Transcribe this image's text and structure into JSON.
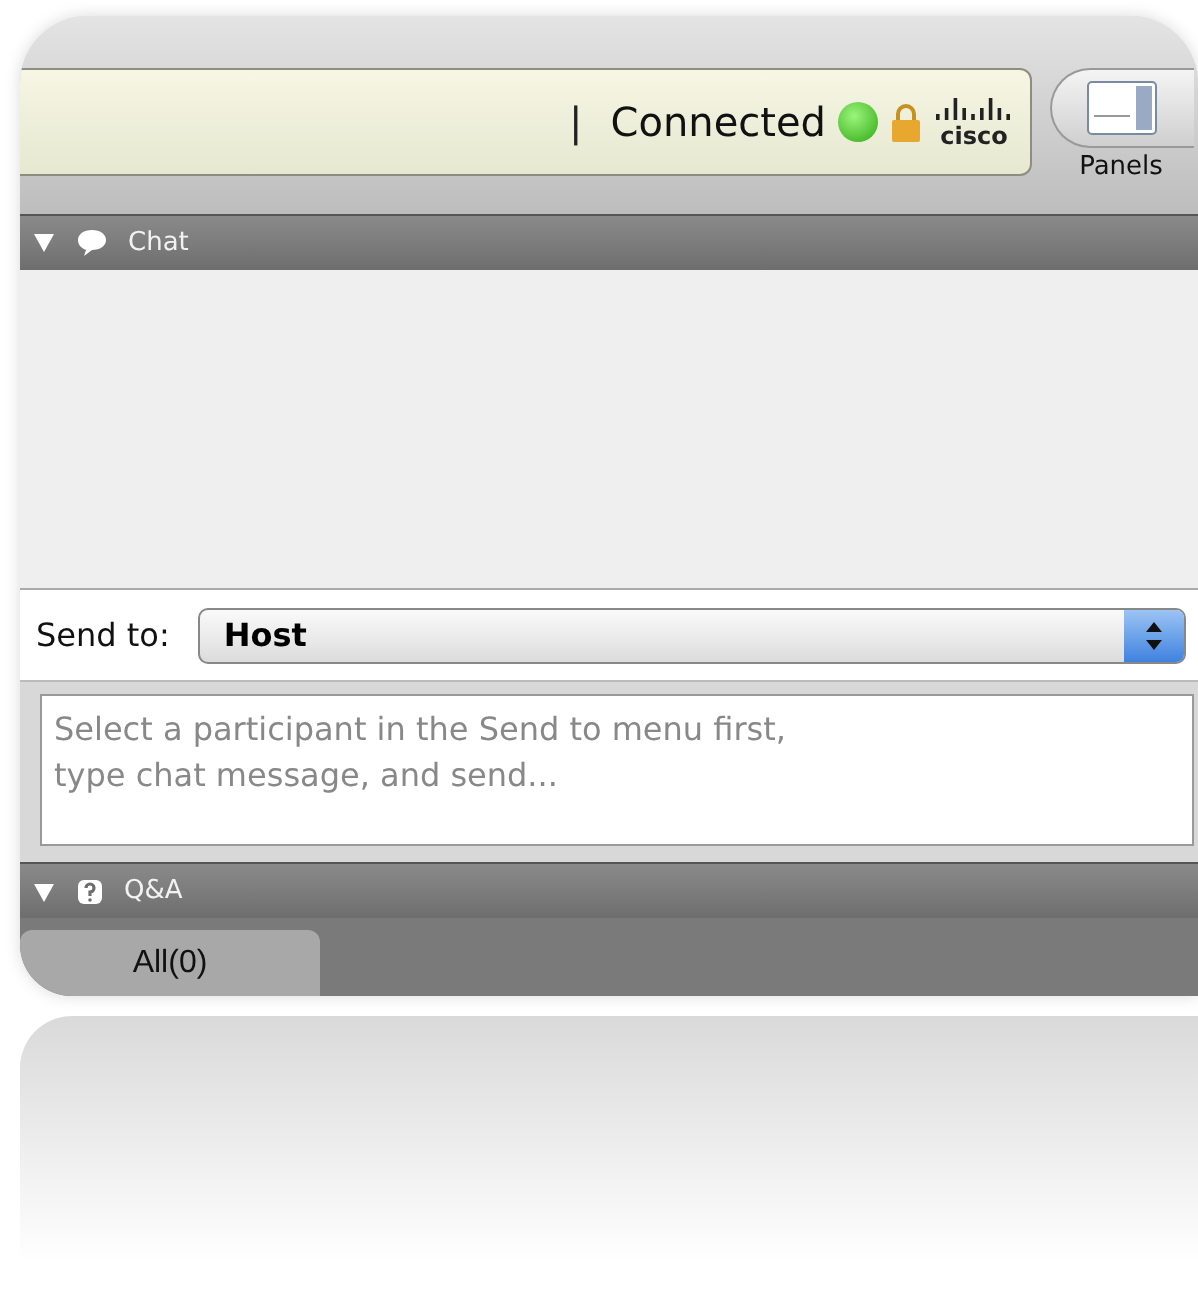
{
  "status": {
    "separator": "|",
    "text": "Connected",
    "connected": true,
    "logo_text": "cisco"
  },
  "panels_button": {
    "label": "Panels"
  },
  "chat": {
    "title": "Chat",
    "expanded": true,
    "send_to": {
      "label": "Send to:",
      "value": "Host"
    },
    "message": {
      "placeholder": "Select a participant in the Send to menu first,\ntype chat message, and send..."
    }
  },
  "qa": {
    "title": "Q&A",
    "expanded": true,
    "tabs": [
      {
        "label": "All(0)",
        "selected": true
      }
    ]
  }
}
